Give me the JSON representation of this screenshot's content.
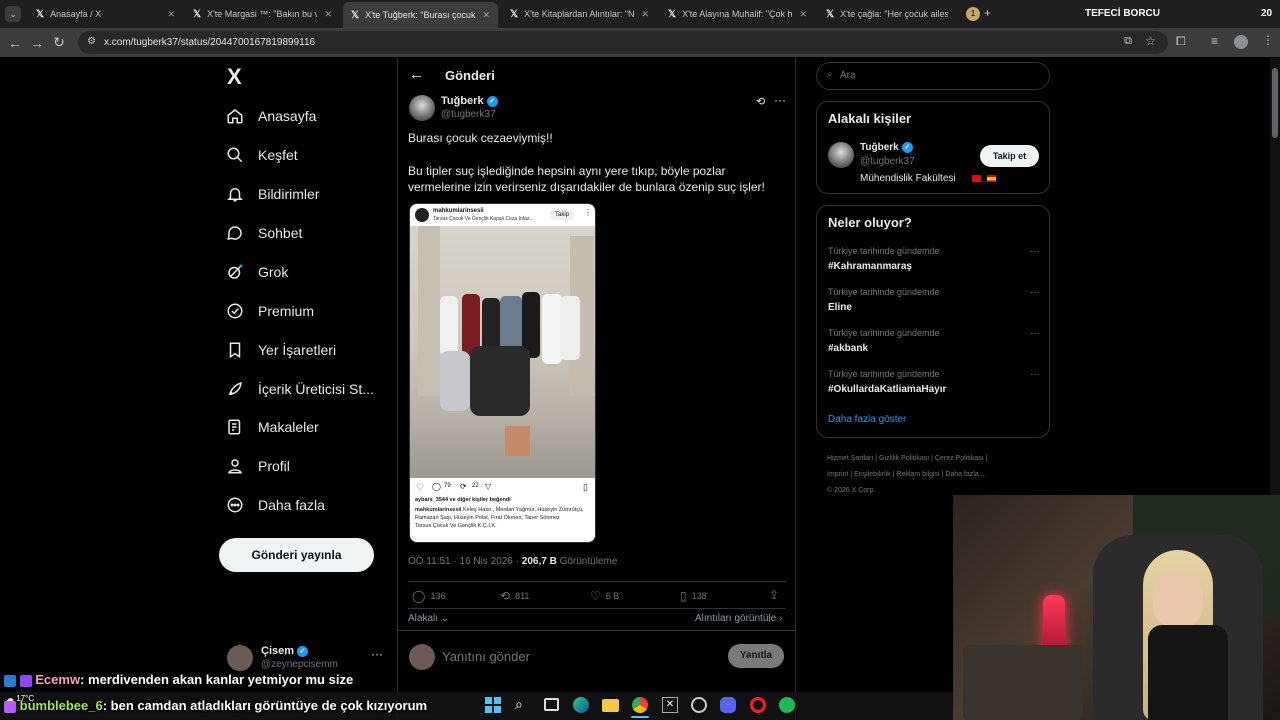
{
  "browser": {
    "tabs": [
      {
        "title": "Anasayfa / X"
      },
      {
        "title": "X'te Margasi ™: \"Bakın bu video"
      },
      {
        "title": "X'te Tuğberk: \"Burası çocuk ceza"
      },
      {
        "title": "X'te Kitaplardan Alıntılar: \"Neyi"
      },
      {
        "title": "X'te Alayına Muhalif: \"Çok haklı"
      },
      {
        "title": "X'te çağla: \"Her çocuk ailesinin"
      }
    ],
    "tab_badge": "1",
    "stream_title": "TEFECİ BORCU",
    "stream_counter": "20",
    "url": "x.com/tugberk37/status/2044700167819899116"
  },
  "nav": {
    "logo": "X",
    "items": [
      {
        "label": "Anasayfa",
        "icon": "home-icon"
      },
      {
        "label": "Keşfet",
        "icon": "search-icon"
      },
      {
        "label": "Bildirimler",
        "icon": "bell-icon"
      },
      {
        "label": "Sohbet",
        "icon": "chat-icon"
      },
      {
        "label": "Grok",
        "icon": "grok-icon"
      },
      {
        "label": "Premium",
        "icon": "premium-icon"
      },
      {
        "label": "Yer İşaretleri",
        "icon": "bookmark-icon"
      },
      {
        "label": "İçerik Üreticisi St...",
        "icon": "rocket-icon"
      },
      {
        "label": "Makaleler",
        "icon": "article-icon"
      },
      {
        "label": "Profil",
        "icon": "person-icon"
      },
      {
        "label": "Daha fazla",
        "icon": "more-circle-icon"
      }
    ],
    "post_button": "Gönderi yayınla",
    "account": {
      "name": "Çisem",
      "handle": "@zeynepcisemm"
    }
  },
  "post": {
    "header_title": "Gönderi",
    "author_name": "Tuğberk",
    "author_handle": "@tugberk37",
    "text_line1": "Burası çocuk cezaeviymiş!!",
    "text_para2": "Bu tipler suç işlediğinde hepsini aynı yere tıkıp, böyle pozlar vermelerine izin verirseniz dışarıdakiler de bunlara özenip suç işler!",
    "embed": {
      "account": "mahkumlarinsesii",
      "location": "Tarsus Çocuk Ve Gençlik Kapalı Ceza İnfaz...",
      "follow": "Takip",
      "comments": "79",
      "shares": "22",
      "liked_by": "aybars_3544 ve diğer kişiler beğendi",
      "caption_user": "mahkumlarinsesii",
      "caption": "Keleş Haso , Merdan Yağmur, Hüseyin Zümrütçü,",
      "caption2": "Ramazan Şaşi, Hüseyin Polat, Fırat Ökmen, Taner Sönmez",
      "caption3": "Tarsus Çocuk Ve Gençlik K.Ç.İ.K."
    },
    "timestamp": "ÖÖ 11:51 · 16 Nis 2026 · ",
    "views_value": "206,7 B",
    "views_label": " Görüntüleme",
    "stats": {
      "replies": "136",
      "reposts": "811",
      "likes": "6 B",
      "bookmarks": "138"
    },
    "relevant": "Alakalı",
    "quotes_link": "Alıntıları görüntüle",
    "reply_placeholder": "Yanıtını gönder",
    "reply_button": "Yanıtla"
  },
  "sidebar": {
    "search_placeholder": "Ara",
    "related_title": "Alakalı kişiler",
    "related_person": {
      "name": "Tuğberk",
      "handle": "@tugberk37",
      "bio": "Mühendislik Fakültesi",
      "follow": "Takip et"
    },
    "trends_title": "Neler oluyor?",
    "trends": [
      {
        "category": "Türkiye tarihinde gündemde",
        "name": "#Kahramanmaraş"
      },
      {
        "category": "Türkiye tarihinde gündemde",
        "name": "Eline"
      },
      {
        "category": "Türkiye tarihinde gündemde",
        "name": "#akbank"
      },
      {
        "category": "Türkiye tarihinde gündemde",
        "name": "#OkullardaKatliamaHayır"
      }
    ],
    "show_more": "Daha fazla göster",
    "footer": [
      "Hizmet Şartları",
      "Gizlilik Politikası",
      "Çerez Politikası",
      "Imprint",
      "Erişilebilirlik",
      "Reklam bilgisi",
      "Daha fazla ...",
      "© 2026 X Corp."
    ]
  },
  "overlay": {
    "chat": [
      {
        "user": "Ecemw",
        "message": ": merdivenden akan kanlar yetmiyor mu size"
      },
      {
        "user": "bumblebee_6",
        "message": ": ben camdan atladıkları görüntüye de çok kızıyorum"
      }
    ],
    "weather": "17°C"
  },
  "colors": {
    "accent": "#1d9bf0",
    "background": "#000000",
    "border": "#2f3336",
    "muted": "#71767b"
  }
}
